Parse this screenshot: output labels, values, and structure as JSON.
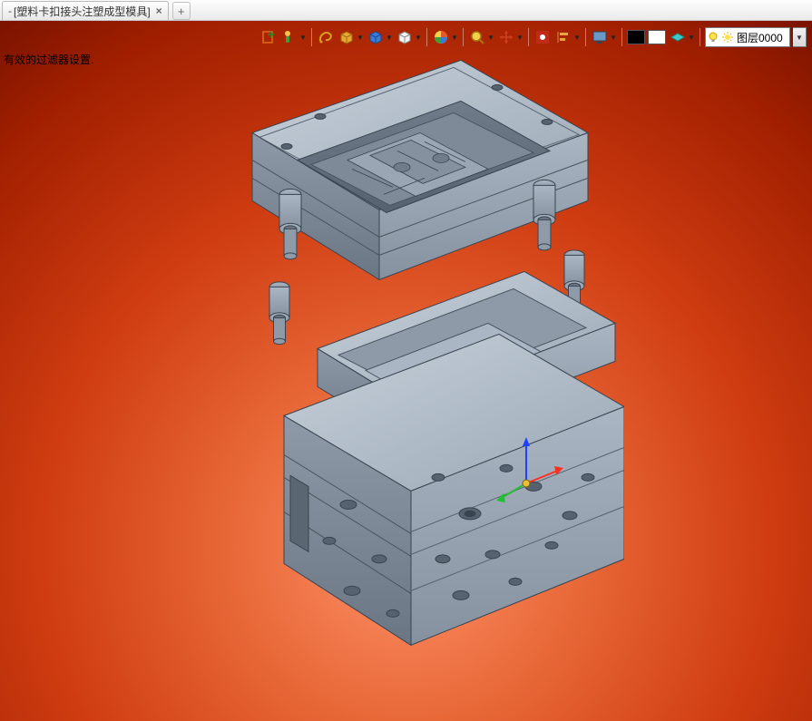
{
  "tab": {
    "prefix": "-",
    "title": "[塑料卡扣接头注塑成型模具]",
    "close": "×",
    "new_tab": "+"
  },
  "status": {
    "filter_text": "有效的过滤器设置."
  },
  "toolbar": {
    "icons": {
      "import": "import-icon",
      "paint": "paint-brush-icon",
      "lasso": "lasso-icon",
      "box_yellow": "view-box-gold-icon",
      "box_blue": "view-box-blue-icon",
      "box_white": "view-box-white-icon",
      "palette": "swatches-icon",
      "zoom": "magnifier-icon",
      "move": "move-handle-icon",
      "record": "record-icon",
      "align": "align-left-icon",
      "monitor": "monitor-icon",
      "sw_black": "swatch-black",
      "sw_white": "swatch-white",
      "layer_slab": "layer-slab-icon",
      "bulb": "lightbulb-icon",
      "sun": "sun-icon"
    }
  },
  "layer": {
    "label": "图层0000"
  },
  "colors": {
    "gold": "#d8a020",
    "blue": "#2a6cc8",
    "cyan": "#36c7d6",
    "green": "#2aa52a",
    "red": "#d04020",
    "orange": "#f08a20",
    "gray": "#7e8da0",
    "steel": "#9aa7b4"
  }
}
